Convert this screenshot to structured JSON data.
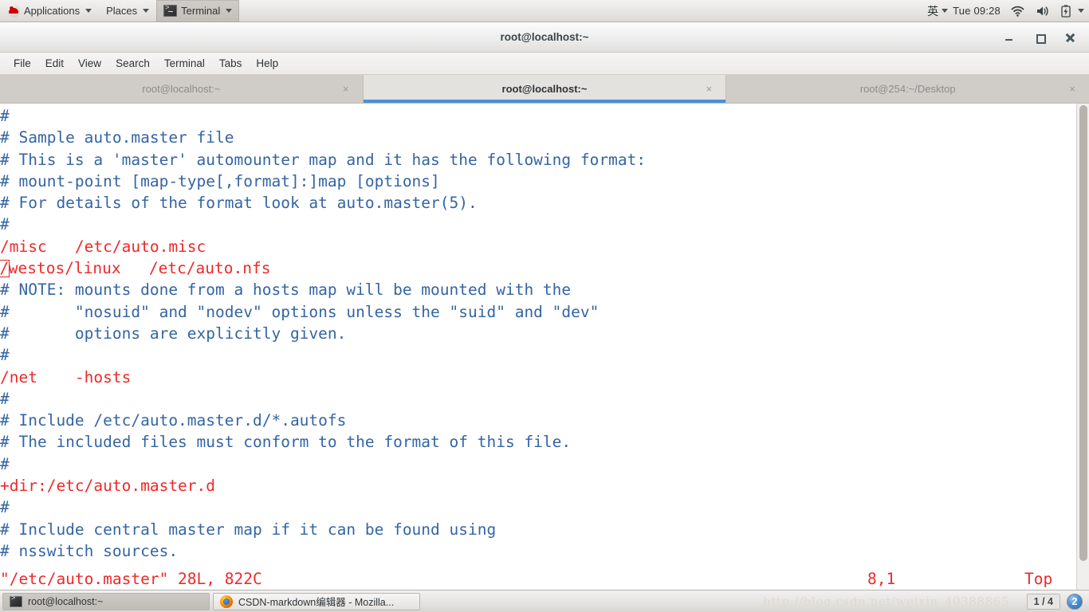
{
  "top_panel": {
    "applications_label": "Applications",
    "places_label": "Places",
    "active_window_label": "Terminal",
    "ime_label": "英",
    "clock": "Tue 09:28",
    "tray": {
      "wifi": "wifi-icon",
      "volume": "volume-icon",
      "battery": "battery-icon"
    }
  },
  "window": {
    "title": "root@localhost:~",
    "buttons": {
      "minimize": "−",
      "maximize": "□",
      "close": "×"
    }
  },
  "menubar": {
    "items": [
      {
        "label": "File"
      },
      {
        "label": "Edit"
      },
      {
        "label": "View"
      },
      {
        "label": "Search"
      },
      {
        "label": "Terminal"
      },
      {
        "label": "Tabs"
      },
      {
        "label": "Help"
      }
    ]
  },
  "tabs": [
    {
      "label": "root@localhost:~",
      "close": "×",
      "active": false
    },
    {
      "label": "root@localhost:~",
      "close": "×",
      "active": true
    },
    {
      "label": "root@254:~/Desktop",
      "close": "×",
      "active": false
    }
  ],
  "terminal": {
    "colors": {
      "comment": "#3465a4",
      "entry": "#ef2929",
      "background": "#ffffff"
    },
    "lines": [
      {
        "text": "#",
        "color": "comment"
      },
      {
        "text": "# Sample auto.master file",
        "color": "comment"
      },
      {
        "text": "# This is a 'master' automounter map and it has the following format:",
        "color": "comment"
      },
      {
        "text": "# mount-point [map-type[,format]:]map [options]",
        "color": "comment"
      },
      {
        "text": "# For details of the format look at auto.master(5).",
        "color": "comment"
      },
      {
        "text": "#",
        "color": "comment"
      },
      {
        "text": "/misc\t/etc/auto.misc",
        "color": "entry"
      },
      {
        "text": "/westos/linux\t/etc/auto.nfs",
        "color": "entry",
        "cursor_col": 0
      },
      {
        "text": "# NOTE: mounts done from a hosts map will be mounted with the",
        "color": "comment"
      },
      {
        "text": "#       \"nosuid\" and \"nodev\" options unless the \"suid\" and \"dev\"",
        "color": "comment"
      },
      {
        "text": "#       options are explicitly given.",
        "color": "comment"
      },
      {
        "text": "#",
        "color": "comment"
      },
      {
        "text": "/net\t-hosts",
        "color": "entry"
      },
      {
        "text": "#",
        "color": "comment"
      },
      {
        "text": "# Include /etc/auto.master.d/*.autofs",
        "color": "comment"
      },
      {
        "text": "# The included files must conform to the format of this file.",
        "color": "comment"
      },
      {
        "text": "#",
        "color": "comment"
      },
      {
        "text": "+dir:/etc/auto.master.d",
        "color": "entry"
      },
      {
        "text": "#",
        "color": "comment"
      },
      {
        "text": "# Include central master map if it can be found using",
        "color": "comment"
      },
      {
        "text": "# nsswitch sources.",
        "color": "comment"
      }
    ],
    "status": {
      "file": "\"/etc/auto.master\" 28L, 822C",
      "position": "8,1",
      "percent": "Top"
    }
  },
  "taskbar": {
    "windows": [
      {
        "label": "root@localhost:~",
        "icon": "terminal-icon",
        "active": true
      },
      {
        "label": "CSDN-markdown编辑器 - Mozilla...",
        "icon": "firefox-icon",
        "active": false
      }
    ],
    "watermark": "http://blog.csdn.net/weixin_40388865",
    "workspace_pager": "1 / 4",
    "notification_badge": "2"
  }
}
